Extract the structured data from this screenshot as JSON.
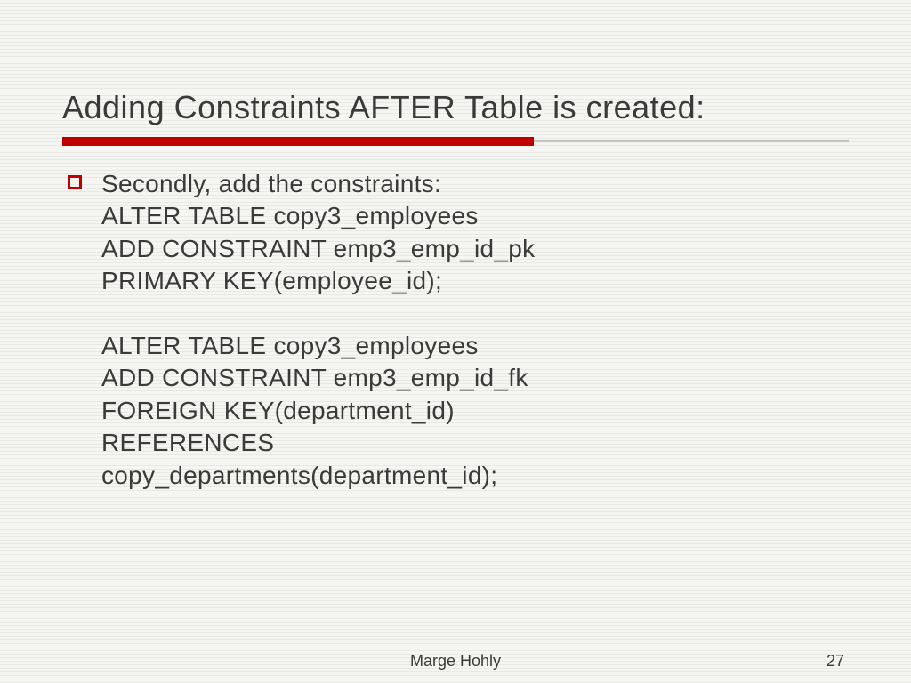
{
  "slide": {
    "title": "Adding Constraints AFTER Table is created:",
    "bullet_intro": "Secondly, add the constraints:",
    "code_line1": "ALTER TABLE copy3_employees",
    "code_line2": "ADD CONSTRAINT emp3_emp_id_pk",
    "code_line3": "PRIMARY KEY(employee_id);",
    "code_line4": "ALTER TABLE copy3_employees",
    "code_line5": "ADD CONSTRAINT emp3_emp_id_fk",
    "code_line6": "FOREIGN KEY(department_id)",
    "code_line7": "REFERENCES",
    "code_line8": "copy_departments(department_id);"
  },
  "footer": {
    "author": "Marge Hohly",
    "page_number": "27"
  }
}
